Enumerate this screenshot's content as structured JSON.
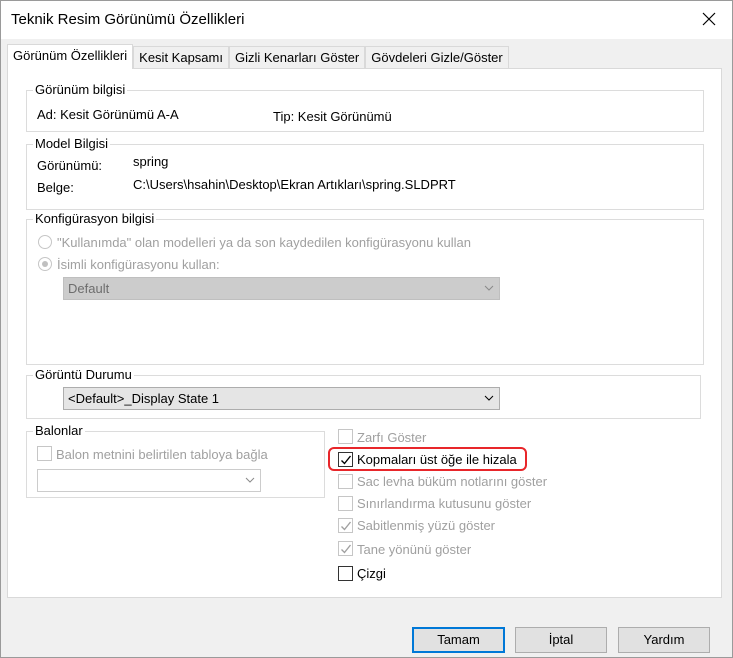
{
  "window": {
    "title": "Teknik Resim Görünümü Özellikleri"
  },
  "tabs": [
    {
      "label": "Görünüm Özellikleri"
    },
    {
      "label": "Kesit Kapsamı"
    },
    {
      "label": "Gizli Kenarları Göster"
    },
    {
      "label": "Gövdeleri Gizle/Göster"
    }
  ],
  "view_info": {
    "title": "Görünüm bilgisi",
    "name": "Ad: Kesit Görünümü A-A",
    "type": "Tip: Kesit Görünümü"
  },
  "model_info": {
    "title": "Model Bilgisi",
    "view_label": "Görünümü:",
    "view_value": "spring",
    "doc_label": "Belge:",
    "doc_value": "C:\\Users\\hsahin\\Desktop\\Ekran Artıkları\\spring.SLDPRT"
  },
  "config_info": {
    "title": "Konfigürasyon bilgisi",
    "option_in_use": "\"Kullanımda\" olan modelleri ya da son kaydedilen konfigürasyonu kullan",
    "option_named": "İsimli konfigürasyonu kullan:",
    "selected_config": "Default"
  },
  "display_state": {
    "title": "Görüntü Durumu",
    "selected": "<Default>_Display State 1"
  },
  "balloons": {
    "title": "Balonlar",
    "link_label": "Balon metnini belirtilen tabloya bağla",
    "table_value": ""
  },
  "options": [
    {
      "label": "Zarfı Göster",
      "checked": false,
      "enabled": false
    },
    {
      "label": "Kopmaları üst öğe ile hizala",
      "checked": true,
      "enabled": true
    },
    {
      "label": "Sac levha büküm notlarını göster",
      "checked": false,
      "enabled": false
    },
    {
      "label": "Sınırlandırma kutusunu göster",
      "checked": false,
      "enabled": false
    },
    {
      "label": "Sabitlenmiş yüzü göster",
      "checked": true,
      "enabled": false
    },
    {
      "label": "Tane yönünü göster",
      "checked": true,
      "enabled": false
    },
    {
      "label": "Çizgi",
      "checked": false,
      "enabled": true
    }
  ],
  "buttons": {
    "ok": "Tamam",
    "cancel": "İptal",
    "help": "Yardım"
  },
  "colors": {
    "highlight": "#e8262a",
    "default_button_border": "#0078d7"
  }
}
